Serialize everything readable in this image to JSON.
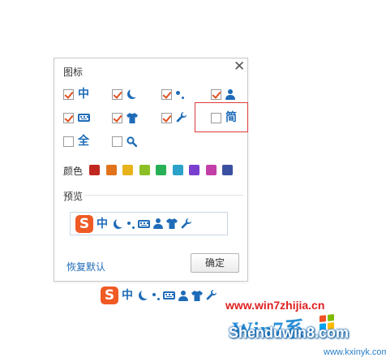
{
  "dialog": {
    "title": "图标",
    "close_glyph": "✕",
    "icons": [
      {
        "id": "zh",
        "glyph": "中",
        "checked": true
      },
      {
        "id": "moon",
        "glyph": "",
        "checked": true
      },
      {
        "id": "punct",
        "glyph": "",
        "checked": true
      },
      {
        "id": "user",
        "glyph": "",
        "checked": true
      },
      {
        "id": "keyboard",
        "glyph": "",
        "checked": true
      },
      {
        "id": "shirt",
        "glyph": "",
        "checked": true
      },
      {
        "id": "wrench",
        "glyph": "",
        "checked": true
      },
      {
        "id": "jian",
        "glyph": "简",
        "checked": false
      },
      {
        "id": "quan",
        "glyph": "全",
        "checked": false
      },
      {
        "id": "search",
        "glyph": "",
        "checked": false
      }
    ],
    "color_label": "颜色",
    "colors": [
      "#c0281f",
      "#e0731c",
      "#e8b21a",
      "#8cc026",
      "#28b056",
      "#2aa2c9",
      "#7a3fcf",
      "#c23fa8",
      "#3b4fa0"
    ],
    "preview_label": "预览",
    "reset_label": "恢复默认",
    "ok_label": "确定"
  },
  "toolbar_preview": {
    "logo_letter": "S",
    "zh_glyph": "中"
  },
  "watermark": {
    "url_top": "www.win7zhijia.cn",
    "logo_text": "Win7系",
    "brand": "Shenduwin8.com",
    "url_bottom": "www.kxinyk.com"
  },
  "accent_color": "#1e6bb8",
  "check_color": "#e0501e",
  "highlight_color": "#e03a3a"
}
